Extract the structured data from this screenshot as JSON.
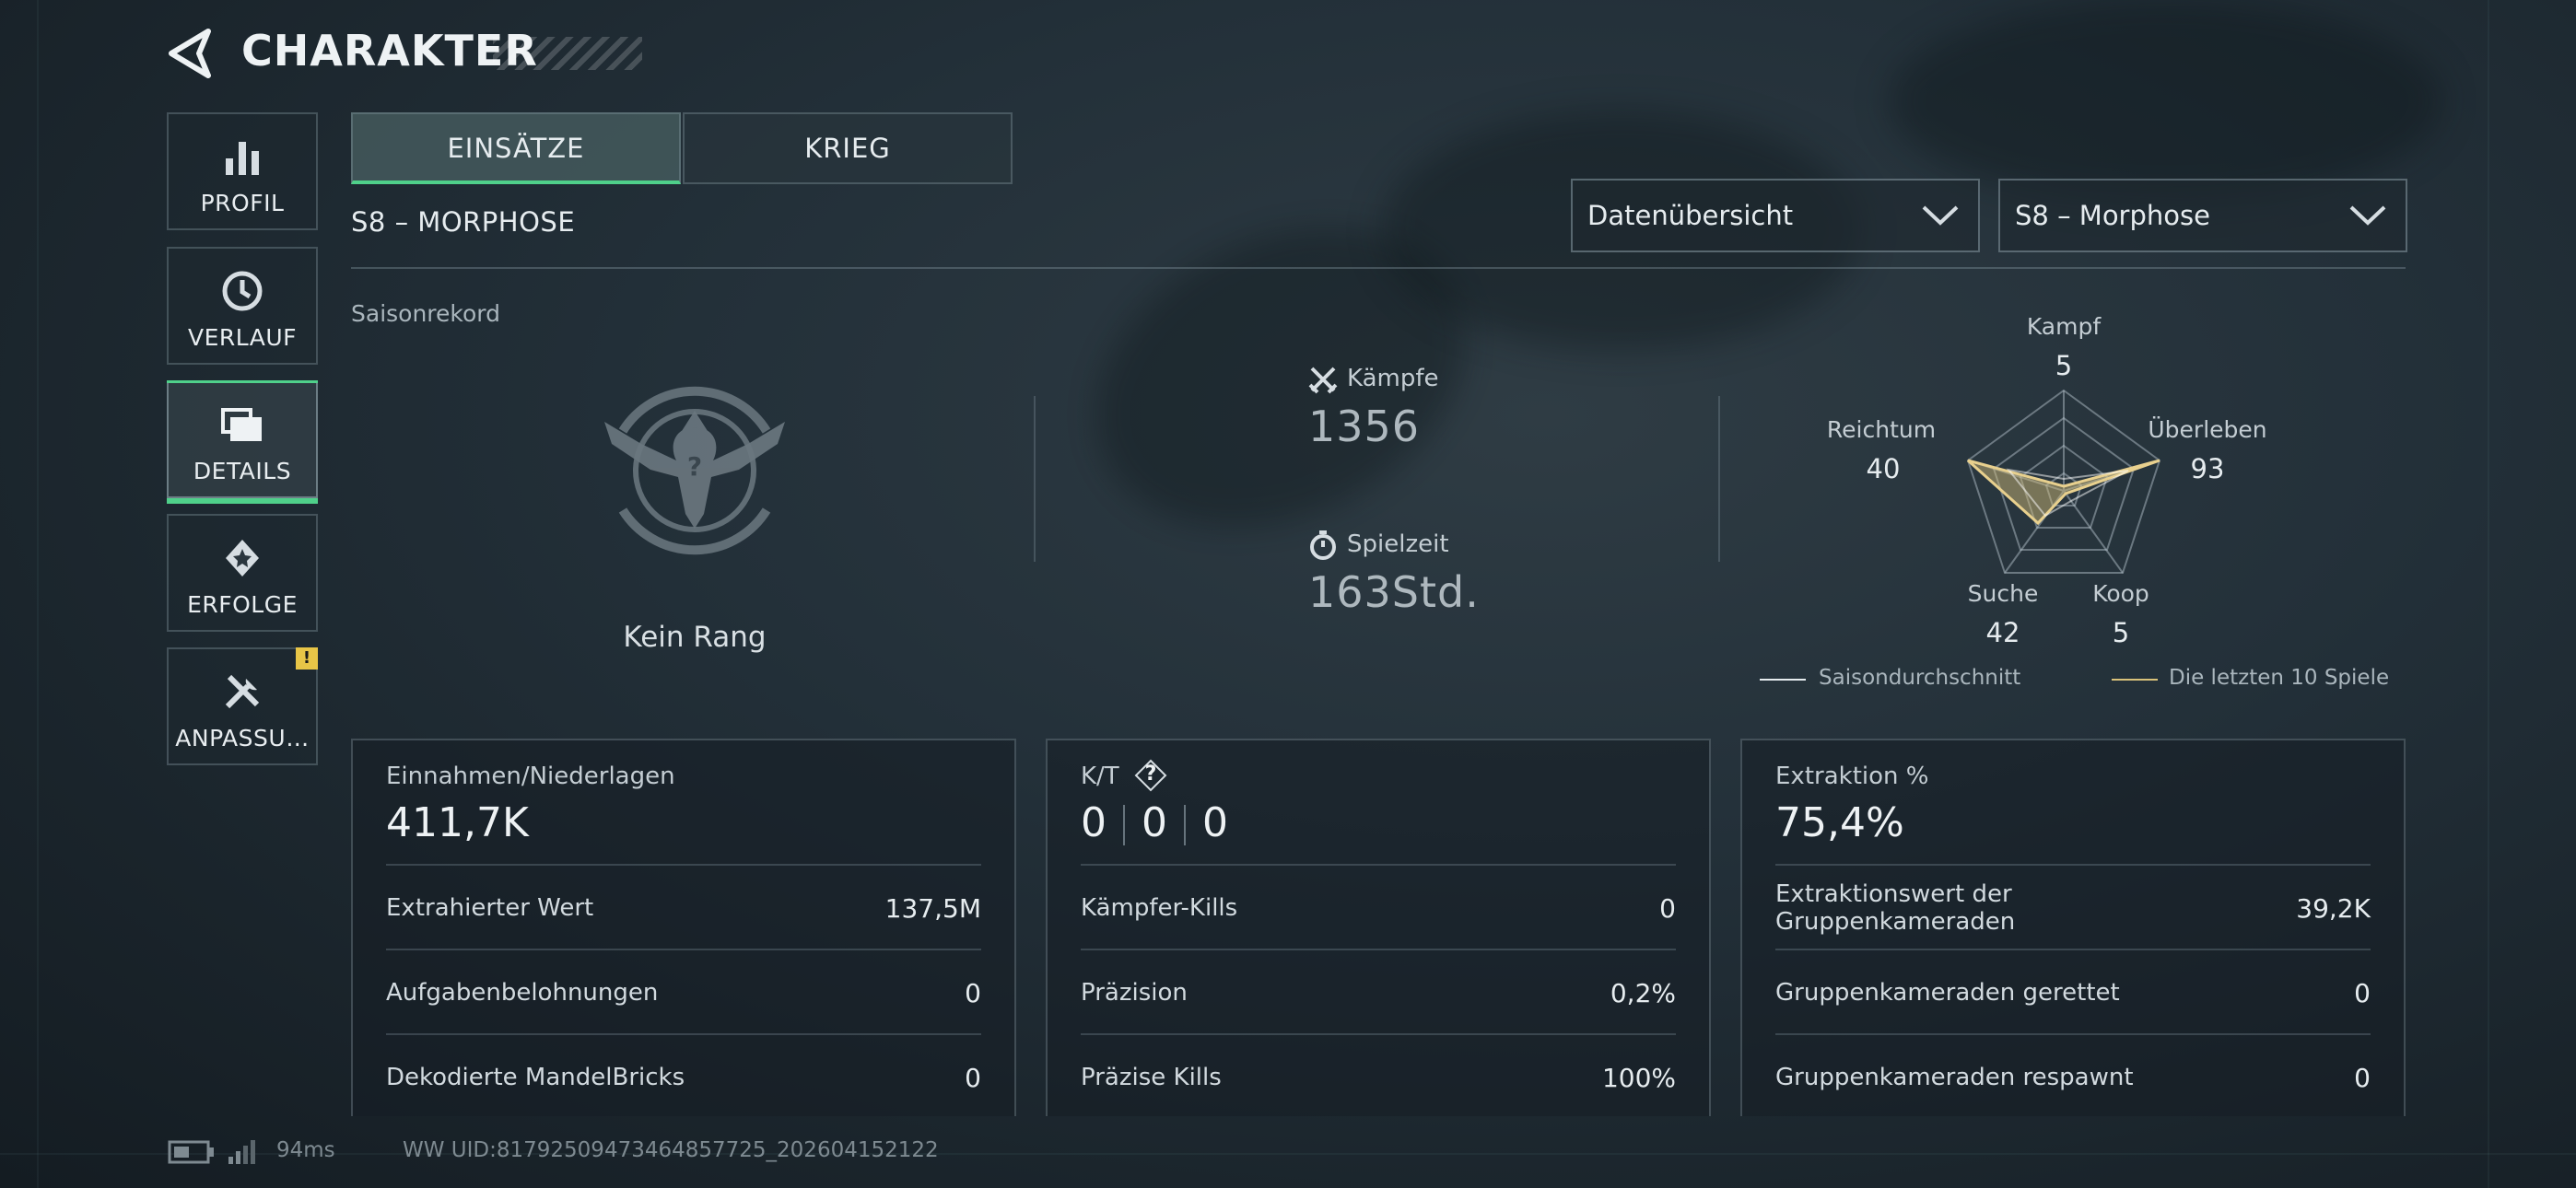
{
  "header": {
    "title": "CHARAKTER"
  },
  "sidebar": {
    "items": [
      {
        "label": "PROFIL",
        "icon": "bar-chart-icon"
      },
      {
        "label": "VERLAUF",
        "icon": "history-icon"
      },
      {
        "label": "DETAILS",
        "icon": "folder-icon",
        "active": true
      },
      {
        "label": "ERFOLGE",
        "icon": "medal-icon"
      },
      {
        "label": "ANPASSU…",
        "icon": "tools-icon",
        "badge": "!"
      }
    ]
  },
  "tabs": [
    {
      "label": "EINSÄTZE",
      "active": true
    },
    {
      "label": "KRIEG",
      "active": false
    }
  ],
  "season": {
    "title": "S8 – MORPHOSE"
  },
  "dropdowns": {
    "view": "Datenübersicht",
    "season": "S8 – Morphose"
  },
  "record": {
    "label": "Saisonrekord",
    "rank": "Kein Rang",
    "fights_label": "Kämpfe",
    "fights_value": "1356",
    "playtime_label": "Spielzeit",
    "playtime_value": "163Std."
  },
  "radar": {
    "axes": [
      {
        "label": "Kampf",
        "value": "5"
      },
      {
        "label": "Überleben",
        "value": "93"
      },
      {
        "label": "Koop",
        "value": "5"
      },
      {
        "label": "Suche",
        "value": "42"
      },
      {
        "label": "Reichtum",
        "value": "40"
      }
    ],
    "legend": {
      "season_avg": "Saisondurchschnitt",
      "last10": "Die letzten 10 Spiele"
    },
    "colors": {
      "season_avg": "#e6ecef",
      "last10": "#d9c27a"
    }
  },
  "cards": {
    "income": {
      "title": "Einnahmen/Niederlagen",
      "value": "411,7K",
      "rows": [
        {
          "label": "Extrahierter Wert",
          "value": "137,5M"
        },
        {
          "label": "Aufgabenbelohnungen",
          "value": "0"
        },
        {
          "label": "Dekodierte MandelBricks",
          "value": "0"
        }
      ]
    },
    "kd": {
      "title": "K/T",
      "help": "?",
      "values": [
        "0",
        "0",
        "0"
      ],
      "rows": [
        {
          "label": "Kämpfer-Kills",
          "value": "0"
        },
        {
          "label": "Präzision",
          "value": "0,2%"
        },
        {
          "label": "Präzise Kills",
          "value": "100%"
        }
      ]
    },
    "extraction": {
      "title": "Extraktion %",
      "value": "75,4%",
      "rows": [
        {
          "label": "Extraktionswert der Gruppenkameraden",
          "value": "39,2K"
        },
        {
          "label": "Gruppenkameraden gerettet",
          "value": "0"
        },
        {
          "label": "Gruppenkameraden respawnt",
          "value": "0"
        }
      ]
    }
  },
  "footer": {
    "ping": "94ms",
    "uid": "WW UID:817925094734648577​25_202604152122"
  },
  "accent": "#4fd08a"
}
